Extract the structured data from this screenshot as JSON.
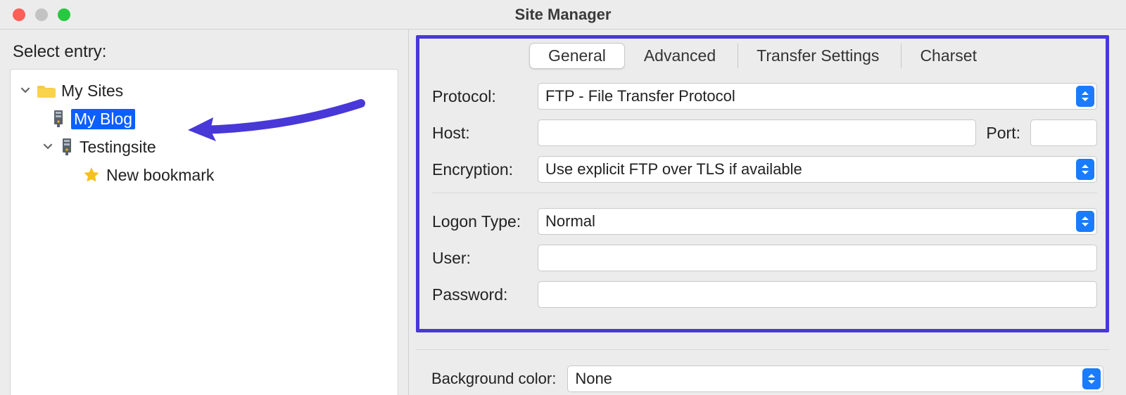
{
  "window": {
    "title": "Site Manager"
  },
  "left": {
    "select_entry_label": "Select entry:",
    "tree": {
      "root_label": "My Sites",
      "selected_label": "My Blog",
      "testing_label": "Testingsite",
      "bookmark_label": "New bookmark"
    }
  },
  "tabs": {
    "general": "General",
    "advanced": "Advanced",
    "transfer": "Transfer Settings",
    "charset": "Charset"
  },
  "form": {
    "protocol_label": "Protocol:",
    "protocol_value": "FTP - File Transfer Protocol",
    "host_label": "Host:",
    "host_value": "",
    "port_label": "Port:",
    "port_value": "",
    "encryption_label": "Encryption:",
    "encryption_value": "Use explicit FTP over TLS if available",
    "logon_type_label": "Logon Type:",
    "logon_type_value": "Normal",
    "user_label": "User:",
    "user_value": "",
    "password_label": "Password:",
    "password_value": ""
  },
  "bgcolor": {
    "label": "Background color:",
    "value": "None"
  }
}
